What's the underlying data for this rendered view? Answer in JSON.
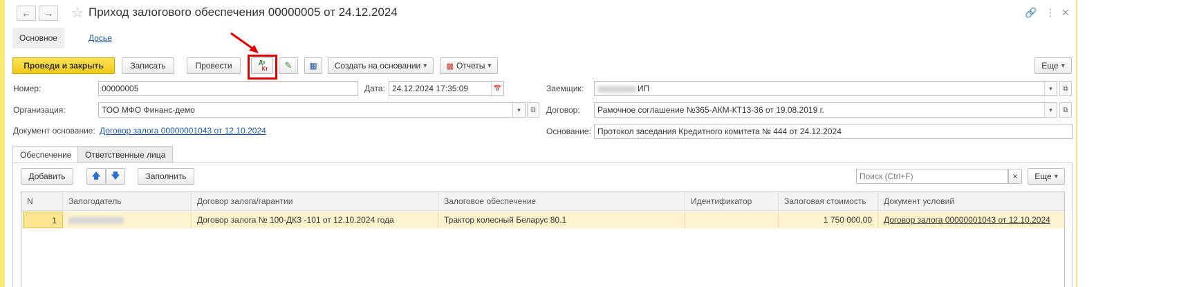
{
  "window": {
    "title": "Приход залогового обеспечения 00000005 от 24.12.2024"
  },
  "sections": {
    "main_tab": "Основное",
    "dossier_tab": "Досье"
  },
  "toolbar": {
    "post_close": "Проведи и закрыть",
    "save": "Записать",
    "post": "Провести",
    "dtkt_top": "Дт",
    "dtkt_bottom": "Кт",
    "create_based": "Создать на основании",
    "reports": "Отчеты",
    "more": "Еще"
  },
  "form": {
    "number_label": "Номер:",
    "number_value": "00000005",
    "date_label": "Дата:",
    "date_value": "24.12.2024 17:35:09",
    "org_label": "Организация:",
    "org_value": "ТОО МФО Финанс-демо",
    "base_doc_label": "Документ основание:",
    "base_doc_value": "Договор залога 00000001043 от 12.10.2024",
    "borrower_label": "Заемщик:",
    "borrower_value": "ИП",
    "contract_label": "Договор:",
    "contract_value": "Рамочное соглашение №365-АКМ-КТ13-36 от 19.08.2019 г.",
    "reason_label": "Основание:",
    "reason_value": "Протокол заседания Кредитного комитета № 444 от 24.12.2024"
  },
  "inner_tabs": {
    "collateral": "Обеспечение",
    "responsible": "Ответственные лица"
  },
  "table_toolbar": {
    "add": "Добавить",
    "fill": "Заполнить",
    "search_placeholder": "Поиск (Ctrl+F)",
    "clear": "×",
    "more": "Еще"
  },
  "table": {
    "headers": {
      "n": "N",
      "pledger": "Залогодатель",
      "pledge_contract": "Договор залога/гарантии",
      "collateral": "Залоговое обеспечение",
      "identifier": "Идентификатор",
      "value": "Залоговая стоимость",
      "terms_doc": "Документ условий"
    },
    "rows": [
      {
        "n": "1",
        "pledger": "",
        "pledge_contract": "Договор залога № 100-ДКЗ -101 от 12.10.2024 года",
        "collateral": "Трактор колесный Беларус 80.1",
        "identifier": "",
        "value": "1 750 000,00",
        "terms_doc": "Договор залога 00000001043 от 12.10.2024"
      }
    ]
  },
  "colors": {
    "primary_button": "#f1c91a",
    "selected_row": "#fdf4cf",
    "annotation": "#e00000",
    "link": "#1a56a7"
  }
}
